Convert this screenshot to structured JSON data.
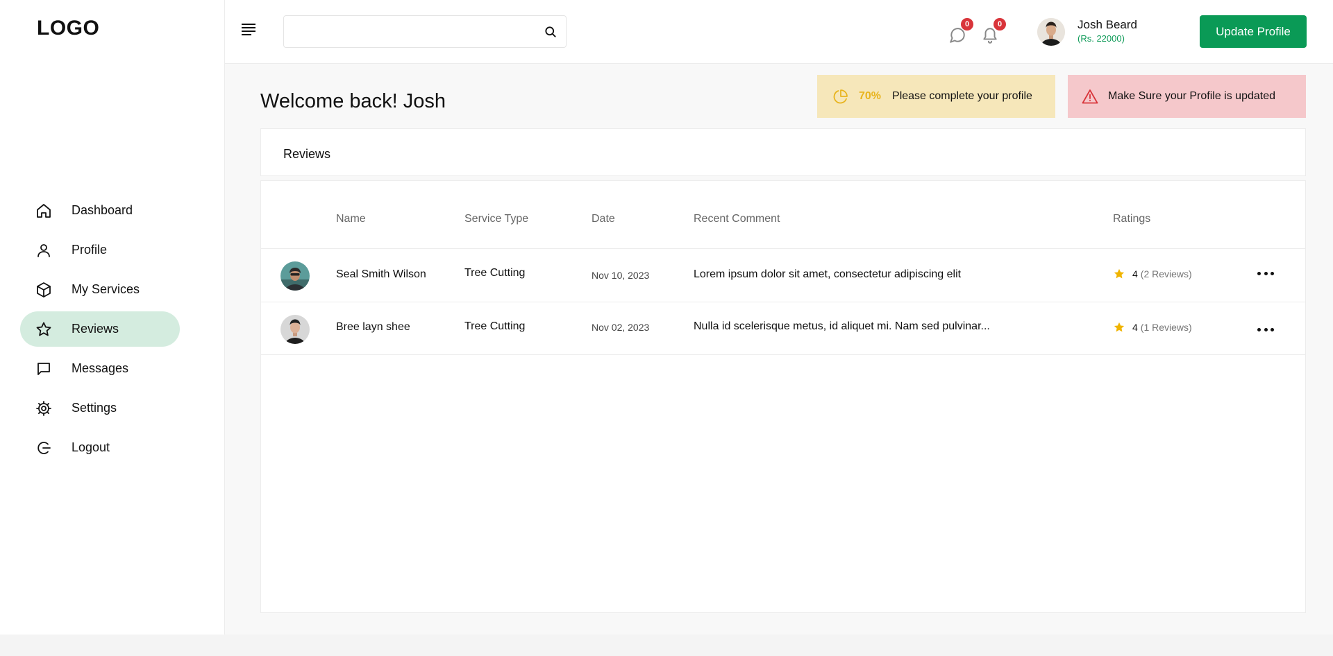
{
  "logo": "LOGO",
  "sidebar": {
    "items": [
      {
        "label": "Dashboard",
        "icon": "home-icon"
      },
      {
        "label": "Profile",
        "icon": "user-icon"
      },
      {
        "label": "My Services",
        "icon": "box-icon"
      },
      {
        "label": "Reviews",
        "icon": "star-icon",
        "active": true
      },
      {
        "label": "Messages",
        "icon": "message-icon"
      },
      {
        "label": "Settings",
        "icon": "gear-icon"
      },
      {
        "label": "Logout",
        "icon": "logout-icon"
      }
    ]
  },
  "header": {
    "search": {
      "placeholder": "",
      "value": ""
    },
    "messages_count": "0",
    "notifications_count": "0",
    "user": {
      "name": "Josh Beard",
      "balance": "(Rs. 22000)"
    },
    "update_button": "Update Profile"
  },
  "welcome": "Welcome back! Josh",
  "alerts": {
    "progress_percent": "70%",
    "progress_text": "Please complete your profile",
    "warning_text": "Make Sure your Profile is updated"
  },
  "reviews_title": "Reviews",
  "table": {
    "columns": [
      "Name",
      "Service Type",
      "Date",
      "Recent Comment",
      "Ratings"
    ],
    "rows": [
      {
        "name": "Seal Smith Wilson",
        "service": "Tree Cutting",
        "date": "Nov 10, 2023",
        "comment": "Lorem ipsum dolor sit amet, consectetur adipiscing elit",
        "rating": "4",
        "reviews": "(2 Reviews)"
      },
      {
        "name": "Bree layn shee",
        "service": "Tree Cutting",
        "date": "Nov 02, 2023",
        "comment": "Nulla id scelerisque metus, id aliquet mi. Nam sed pulvinar...",
        "rating": "4",
        "reviews": "(1 Reviews)"
      }
    ]
  },
  "colors": {
    "accent": "#0a9a56",
    "active_nav": "#d4ecdf",
    "star": "#f0b400",
    "badge": "#d9343a"
  }
}
